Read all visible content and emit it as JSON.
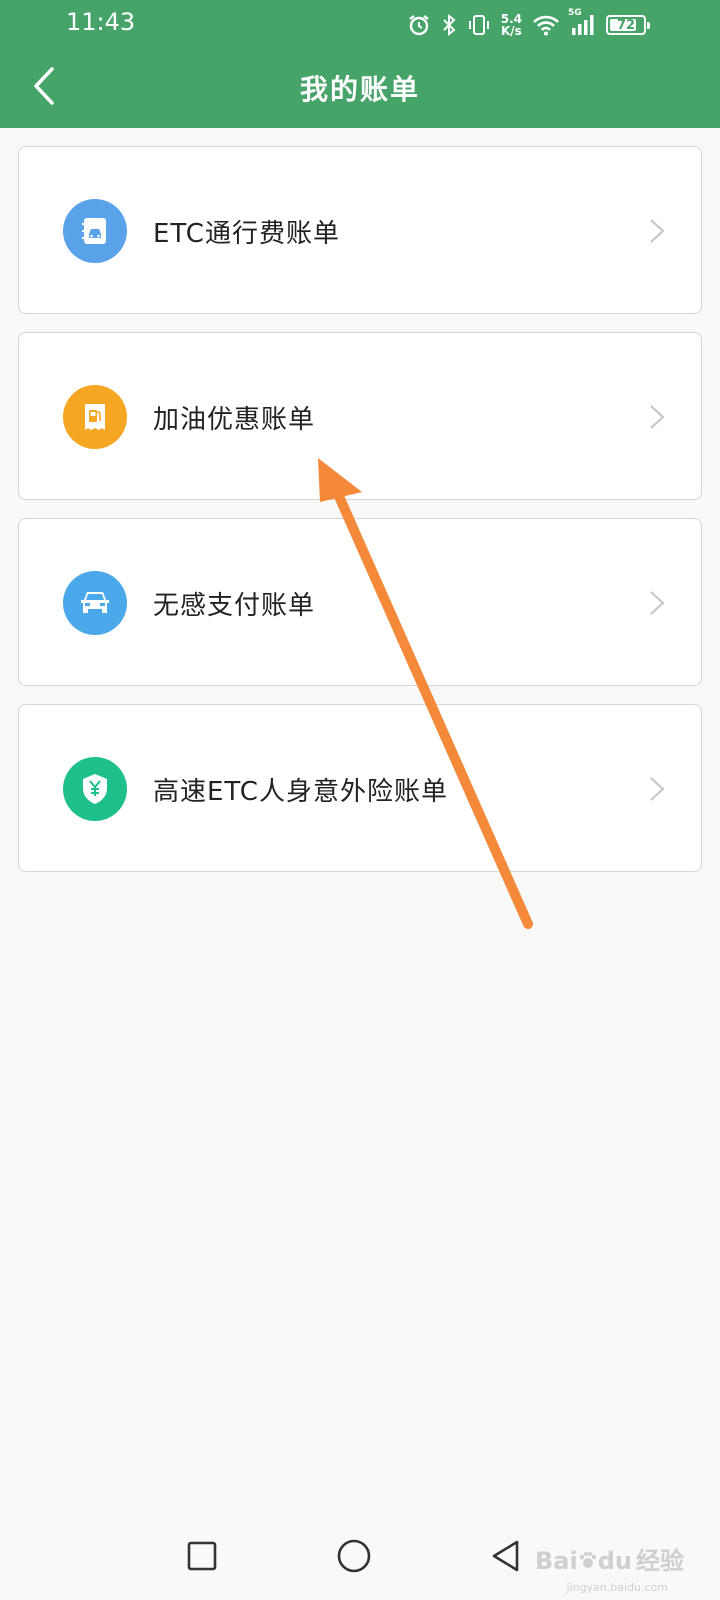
{
  "status_bar": {
    "time": "11:43",
    "net_speed_value": "5.4",
    "net_speed_unit": "K/s",
    "network_type": "5G",
    "battery": "72"
  },
  "header": {
    "title": "我的账单",
    "background": "#46a469"
  },
  "bills": [
    {
      "label": "ETC通行费账单",
      "icon": "etc-card-icon",
      "color": "#5aa3ea"
    },
    {
      "label": "加油优惠账单",
      "icon": "fuel-pump-icon",
      "color": "#f5a623"
    },
    {
      "label": "无感支付账单",
      "icon": "car-icon",
      "color": "#4ba8ea"
    },
    {
      "label": "高速ETC人身意外险账单",
      "icon": "shield-yuan-icon",
      "color": "#1fbf8c"
    }
  ],
  "annotation": {
    "color": "#f5893a"
  },
  "watermark": {
    "brand": "Bai",
    "brand_suffix": "du",
    "product": "经验",
    "url": "jingyan.baidu.com"
  }
}
